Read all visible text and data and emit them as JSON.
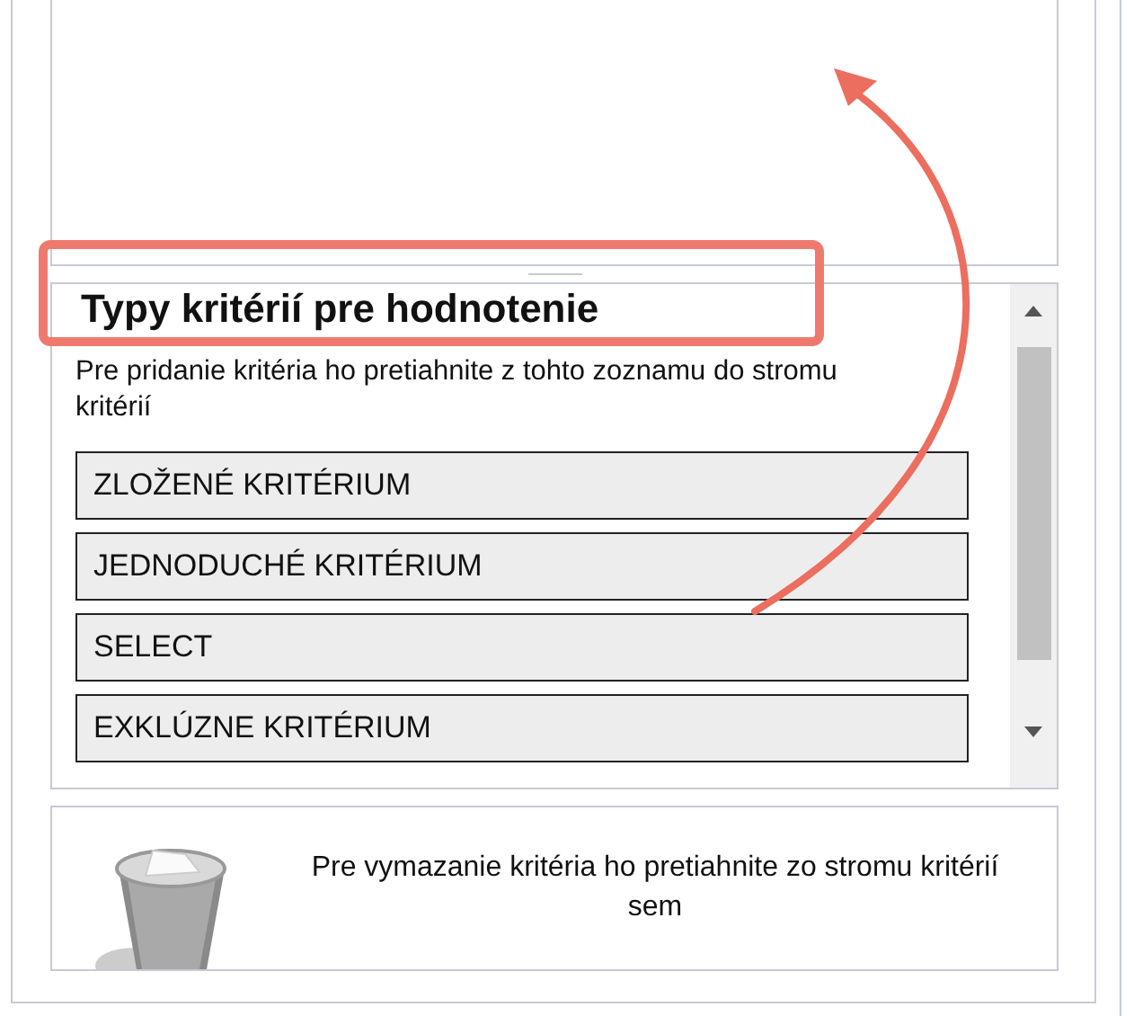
{
  "criteria_panel": {
    "title": "Typy kritérií pre hodnotenie",
    "description": "Pre pridanie kritéria ho pretiahnite z tohto zoznamu do stromu kritérií",
    "items": [
      {
        "label": "ZLOŽENÉ KRITÉRIUM"
      },
      {
        "label": "JEDNODUCHÉ KRITÉRIUM"
      },
      {
        "label": "SELECT"
      },
      {
        "label": "EXKLÚZNE KRITÉRIUM"
      }
    ]
  },
  "trash": {
    "hint": "Pre vymazanie kritéria ho pretiahnite zo stromu kritérií sem"
  }
}
